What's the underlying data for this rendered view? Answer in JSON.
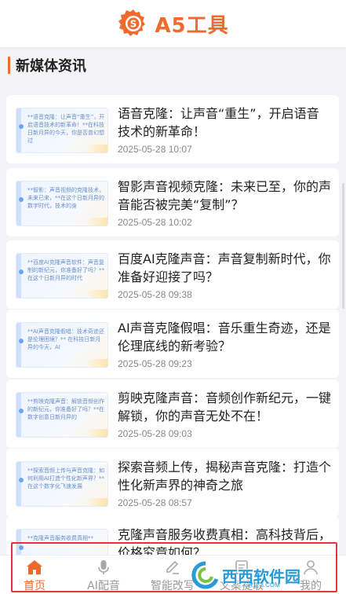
{
  "header": {
    "logo_text": "A5工具"
  },
  "section": {
    "title": "新媒体资讯"
  },
  "articles": [
    {
      "title": "语音克隆：让声音“重生”，开启语音技术的新革命！",
      "date": "2025-05-28 10:07",
      "thumb_text": "**语音克隆：让声音“重生”，开启语音技术的新革命！**在科技日新月异的今天，你是否曾幻想过"
    },
    {
      "title": "智影声音视频克隆：未来已至，你的声音能否被完美“复制”？",
      "date": "2025-05-28 10:02",
      "thumb_text": "**智影：声音视频的克隆技术，未来已来，**在这个日新月异的数字时代，技术的身"
    },
    {
      "title": "百度AI克隆声音：声音复制新时代，你准备好迎接了吗？",
      "date": "2025-05-28 09:38",
      "thumb_text": "**百度AI克隆声音软件：声音复制的新纪元，你准备好了吗？**在这个日新月异的时代"
    },
    {
      "title": "AI声音克隆假唱：音乐重生奇迹，还是伦理底线的新考验？",
      "date": "2025-05-28 09:23",
      "thumb_text": "**AI声音克隆假唱：技术奇迹还是伦理困境？** 在科技日新月异的今天，AI"
    },
    {
      "title": "剪映克隆声音：音频创作新纪元，一键解锁，你的声音无处不在！",
      "date": "2025-05-28 09:03",
      "thumb_text": "**剪映克隆声音：解锁音频创作的新纪元，你准备好了吗？**在数字创意日新月异的"
    },
    {
      "title": "探索音频上传，揭秘声音克隆：打造个性化新声界的神奇之旅",
      "date": "2025-05-28 08:57",
      "thumb_text": "**探索音频上传与声音克隆：如何利用AI打造个性化新声界？**在这个数字化飞速发展"
    },
    {
      "title": "克隆声音服务收费真相：高科技背后，价格究竟如何？",
      "date": "",
      "thumb_text": "**克隆声音服务收费真相**"
    }
  ],
  "bottom_nav": [
    {
      "label": "首页",
      "icon": "home-icon",
      "active": true
    },
    {
      "label": "AI配音",
      "icon": "microphone-icon",
      "active": false
    },
    {
      "label": "智能改写",
      "icon": "edit-icon",
      "active": false
    },
    {
      "label": "文案提取",
      "icon": "document-icon",
      "active": false
    },
    {
      "label": "我的",
      "icon": "user-icon",
      "active": false
    }
  ],
  "watermark": {
    "text": "西西软件园",
    "sub": "CR173.COM"
  },
  "colors": {
    "accent": "#ef6a2d",
    "highlight_border": "#e3343c",
    "watermark": "#2a9bd6"
  }
}
